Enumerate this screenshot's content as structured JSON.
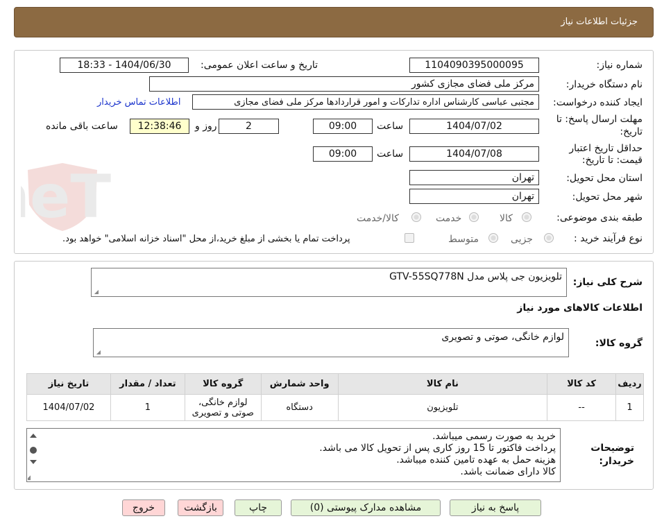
{
  "header": {
    "title": "جزئیات اطلاعات نیاز"
  },
  "watermark": {
    "text": "AriaTender.neT"
  },
  "form": {
    "need_number_label": "شماره نیاز:",
    "need_number": "1104090395000095",
    "announce_label": "تاریخ و ساعت اعلان عمومی:",
    "announce_value": "1404/06/30 - 18:33",
    "buyer_org_label": "نام دستگاه خریدار:",
    "buyer_org": "مرکز ملی فضای مجازی کشور",
    "requester_label": "ایجاد کننده درخواست:",
    "requester": "مجتبی عباسی کارشناس اداره تدارکات و امور قراردادها مرکز ملی فضای مجازی",
    "contact_link": "اطلاعات تماس خریدار",
    "reply_deadline_label_1": "مهلت ارسال پاسخ: تا",
    "reply_deadline_label_2": "تاریخ:",
    "reply_date": "1404/07/02",
    "hour_label": "ساعت",
    "reply_time": "09:00",
    "days": "2",
    "days_label": "روز و",
    "remaining_time": "12:38:46",
    "remaining_label": "ساعت باقی مانده",
    "validity_label_1": "حداقل تاریخ اعتبار",
    "validity_label_2": "قیمت: تا تاریخ:",
    "validity_date": "1404/07/08",
    "validity_time": "09:00",
    "province_label": "استان محل تحویل:",
    "province": "تهران",
    "city_label": "شهر محل تحویل:",
    "city": "تهران",
    "category_label": "طبقه بندی موضوعی:",
    "category_options": [
      "کالا",
      "خدمت",
      "کالا/خدمت"
    ],
    "process_label": "نوع فرآیند خرید :",
    "process_options": [
      "جزیی",
      "متوسط"
    ],
    "treasury_note": "پرداخت تمام یا بخشی از مبلغ خرید،از محل \"اسناد خزانه اسلامی\" خواهد بود."
  },
  "summary": {
    "label": "شرح کلی نیاز:",
    "value": "تلویزیون جی پلاس مدل GTV-55SQ778N",
    "items_heading": "اطلاعات کالاهای مورد نیاز",
    "group_label": "گروه کالا:",
    "group_value": "لوازم خانگی، صوتی و تصویری"
  },
  "table": {
    "headers": [
      "ردیف",
      "کد کالا",
      "نام کالا",
      "واحد شمارش",
      "گروه کالا",
      "تعداد / مقدار",
      "تاریخ نیاز"
    ],
    "rows": [
      [
        "1",
        "--",
        "تلویزیون",
        "دستگاه",
        "لوازم خانگی، صوتی و تصویری",
        "1",
        "1404/07/02"
      ]
    ]
  },
  "notes": {
    "label_1": "توضیحات",
    "label_2": "خریدار:",
    "lines": [
      "خرید به صورت رسمی میباشد.",
      "پرداخت فاکتور تا 15 روز کاری پس از تحویل کالا می باشد.",
      "هزینه حمل به عهده تامین کننده میباشد.",
      "کالا دارای ضمانت باشد."
    ]
  },
  "buttons": {
    "reply": "پاسخ به نیاز",
    "attachments": "مشاهده مدارک پیوستی (0)",
    "print": "چاپ",
    "back": "بازگشت",
    "exit": "خروج"
  },
  "colors": {
    "header_bg": "#8c6a42",
    "remaining_bg": "#ffffcc",
    "green_button": "#e6f5d8",
    "pink_button": "#ffd6d6",
    "link": "#1a33cc"
  }
}
